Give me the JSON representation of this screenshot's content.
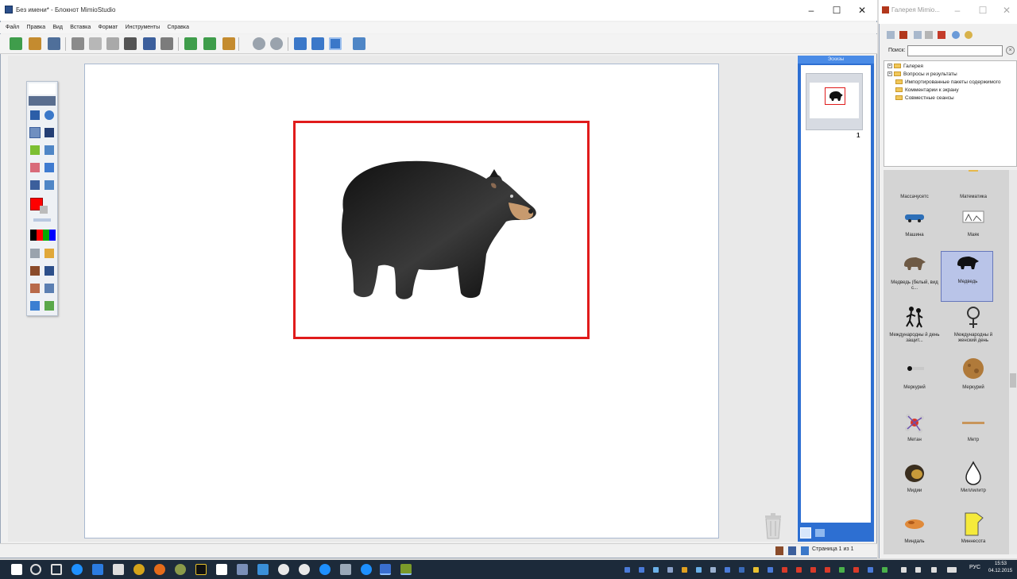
{
  "main_window": {
    "title": "Без имени* - Блокнот MimioStudio",
    "controls": {
      "minimize": "–",
      "maximize": "☐",
      "close": "✕"
    }
  },
  "menu": [
    "Файл",
    "Правка",
    "Вид",
    "Вставка",
    "Формат",
    "Инструменты",
    "Справка"
  ],
  "pages_pane": {
    "header": "Эскизы",
    "page_number": "1"
  },
  "status": {
    "page": "Страница 1 из 1"
  },
  "gallery_window": {
    "title": "Галерея Mimio...",
    "controls": {
      "minimize": "–",
      "maximize": "☐",
      "close": "✕"
    },
    "search_label": "Поиск:",
    "search_value": "",
    "tree": [
      {
        "label": "Галерея",
        "expandable": true
      },
      {
        "label": "Вопросы и результаты",
        "expandable": true
      },
      {
        "label": "Импортированные пакеты содержимого",
        "expandable": false
      },
      {
        "label": "Комментарии к экрану",
        "expandable": false
      },
      {
        "label": "Совместные сеансы",
        "expandable": false
      }
    ],
    "items": [
      {
        "label": "Массачусетс",
        "icon": "massachusetts-icon"
      },
      {
        "label": "Математика",
        "icon": "math-icon"
      },
      {
        "label": "Машина",
        "icon": "car-icon"
      },
      {
        "label": "Маяк",
        "icon": "lighthouse-icon"
      },
      {
        "label": "Медведь (белый, вид с...",
        "icon": "brown-bear-icon"
      },
      {
        "label": "Медведь",
        "icon": "black-bear-icon",
        "selected": true
      },
      {
        "label": "Международны й день защит...",
        "icon": "children-day-icon"
      },
      {
        "label": "Международны й женский день",
        "icon": "female-symbol-icon"
      },
      {
        "label": "Меркурий",
        "icon": "mercury-small-icon"
      },
      {
        "label": "Меркурий",
        "icon": "mercury-planet-icon"
      },
      {
        "label": "Метан",
        "icon": "methane-molecule-icon"
      },
      {
        "label": "Метр",
        "icon": "meter-stick-icon"
      },
      {
        "label": "Мидии",
        "icon": "mussel-icon"
      },
      {
        "label": "Миллилитр",
        "icon": "droplet-icon"
      },
      {
        "label": "Миндаль",
        "icon": "almond-icon"
      },
      {
        "label": "Миннесота",
        "icon": "minnesota-icon"
      }
    ]
  },
  "taskbar": {
    "language": "РУС",
    "time": "15:53",
    "date": "04.12.2015"
  }
}
